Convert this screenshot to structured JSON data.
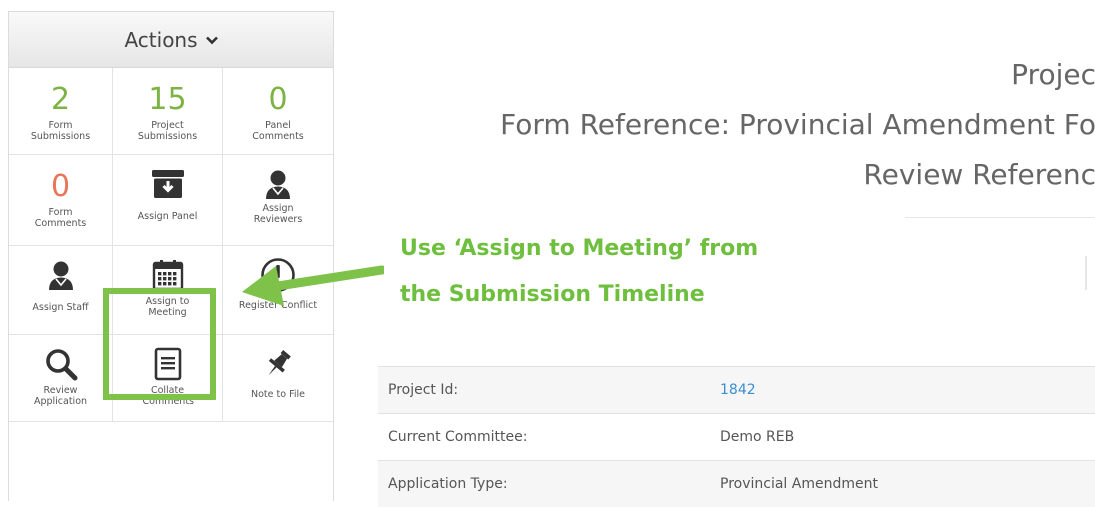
{
  "actions": {
    "title": "Actions",
    "cells": [
      {
        "value": "2",
        "label": "Form Submissions"
      },
      {
        "value": "15",
        "label": "Project Submissions"
      },
      {
        "value": "0",
        "label": "Panel Comments"
      },
      {
        "value": "0",
        "label": "Form Comments"
      },
      {
        "icon": "archive-box-icon",
        "label": "Assign Panel"
      },
      {
        "icon": "person-icon",
        "label": "Assign Reviewers"
      },
      {
        "icon": "person-icon",
        "label": "Assign Staff"
      },
      {
        "icon": "calendar-icon",
        "label": "Assign to Meeting"
      },
      {
        "icon": "exclamation-circle-icon",
        "label": "Register Conflict"
      },
      {
        "icon": "magnifier-icon",
        "label": "Review Application"
      },
      {
        "icon": "document-icon",
        "label": "Collate Comments"
      },
      {
        "icon": "pushpin-icon",
        "label": "Note to File"
      }
    ]
  },
  "callout": {
    "line1": "Use ‘Assign to Meeting’ from",
    "line2": "the Submission Timeline",
    "color": "#6fbf3f"
  },
  "header": {
    "line1": "Projec",
    "line2": "Form Reference: Provincial Amendment Fo",
    "line3": "Review Referenc"
  },
  "details": {
    "rows": [
      {
        "label": "Project Id:",
        "value": "1842"
      },
      {
        "label": "Current Committee:",
        "value": "Demo REB"
      },
      {
        "label": "Application Type:",
        "value": "Provincial Amendment"
      }
    ]
  },
  "colors": {
    "accent_green": "#7cb342",
    "accent_red": "#e8765a",
    "link_blue": "#3b8fd0",
    "highlight": "#7ec24a"
  }
}
